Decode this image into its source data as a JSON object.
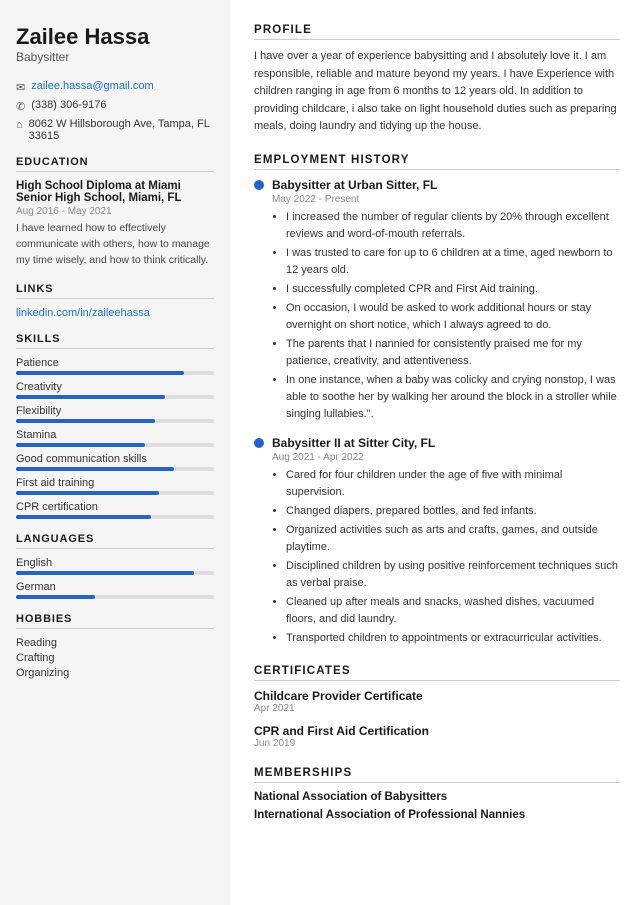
{
  "sidebar": {
    "name": "Zailee Hassa",
    "title": "Babysitter",
    "contact": {
      "email": "zailee.hassa@gmail.com",
      "phone": "(338) 306-9176",
      "address": "8062 W Hillsborough Ave, Tampa, FL 33615"
    },
    "education_title": "EDUCATION",
    "education": {
      "degree": "High School Diploma at Miami Senior High School, Miami, FL",
      "dates": "Aug 2016 - May 2021",
      "description": "I have learned how to effectively communicate with others, how to manage my time wisely, and how to think critically."
    },
    "links_title": "LINKS",
    "links": [
      {
        "label": "linkedin.com/in/zaileehassa",
        "url": "#"
      }
    ],
    "skills_title": "SKILLS",
    "skills": [
      {
        "label": "Patience",
        "pct": 85
      },
      {
        "label": "Creativity",
        "pct": 75
      },
      {
        "label": "Flexibility",
        "pct": 70
      },
      {
        "label": "Stamina",
        "pct": 65
      },
      {
        "label": "Good communication skills",
        "pct": 80
      },
      {
        "label": "First aid training",
        "pct": 72
      },
      {
        "label": "CPR certification",
        "pct": 68
      }
    ],
    "languages_title": "LANGUAGES",
    "languages": [
      {
        "label": "English",
        "pct": 90
      },
      {
        "label": "German",
        "pct": 40
      }
    ],
    "hobbies_title": "HOBBIES",
    "hobbies": [
      "Reading",
      "Crafting",
      "Organizing"
    ]
  },
  "main": {
    "profile_title": "PROFILE",
    "profile_text": "I have over a year of experience babysitting and I absolutely love it. I am responsible, reliable and mature beyond my years. I have Experience with children ranging in age from 6 months to 12 years old. In addition to providing childcare, i also take on light household duties such as preparing meals, doing laundry and tidying up the house.",
    "employment_title": "EMPLOYMENT HISTORY",
    "jobs": [
      {
        "title": "Babysitter at Urban Sitter, FL",
        "dates": "May 2022 - Present",
        "bullets": [
          "I increased the number of regular clients by 20% through excellent reviews and word-of-mouth referrals.",
          "I was trusted to care for up to 6 children at a time, aged newborn to 12 years old.",
          "I successfully completed CPR and First Aid training.",
          "On occasion, I would be asked to work additional hours or stay overnight on short notice, which I always agreed to do.",
          "The parents that I nannied for consistently praised me for my patience, creativity, and attentiveness.",
          "In one instance, when a baby was colicky and crying nonstop, I was able to soothe her by walking her around the block in a stroller while singing lullabies.\"."
        ]
      },
      {
        "title": "Babysitter II at Sitter City, FL",
        "dates": "Aug 2021 - Apr 2022",
        "bullets": [
          "Cared for four children under the age of five with minimal supervision.",
          "Changed diapers, prepared bottles, and fed infants.",
          "Organized activities such as arts and crafts, games, and outside playtime.",
          "Disciplined children by using positive reinforcement techniques such as verbal praise.",
          "Cleaned up after meals and snacks, washed dishes, vacuumed floors, and did laundry.",
          "Transported children to appointments or extracurricular activities."
        ]
      }
    ],
    "certificates_title": "CERTIFICATES",
    "certificates": [
      {
        "name": "Childcare Provider Certificate",
        "date": "Apr 2021"
      },
      {
        "name": "CPR and First Aid Certification",
        "date": "Jun 2019"
      }
    ],
    "memberships_title": "MEMBERSHIPS",
    "memberships": [
      "National Association of Babysitters",
      "International Association of Professional Nannies"
    ]
  }
}
